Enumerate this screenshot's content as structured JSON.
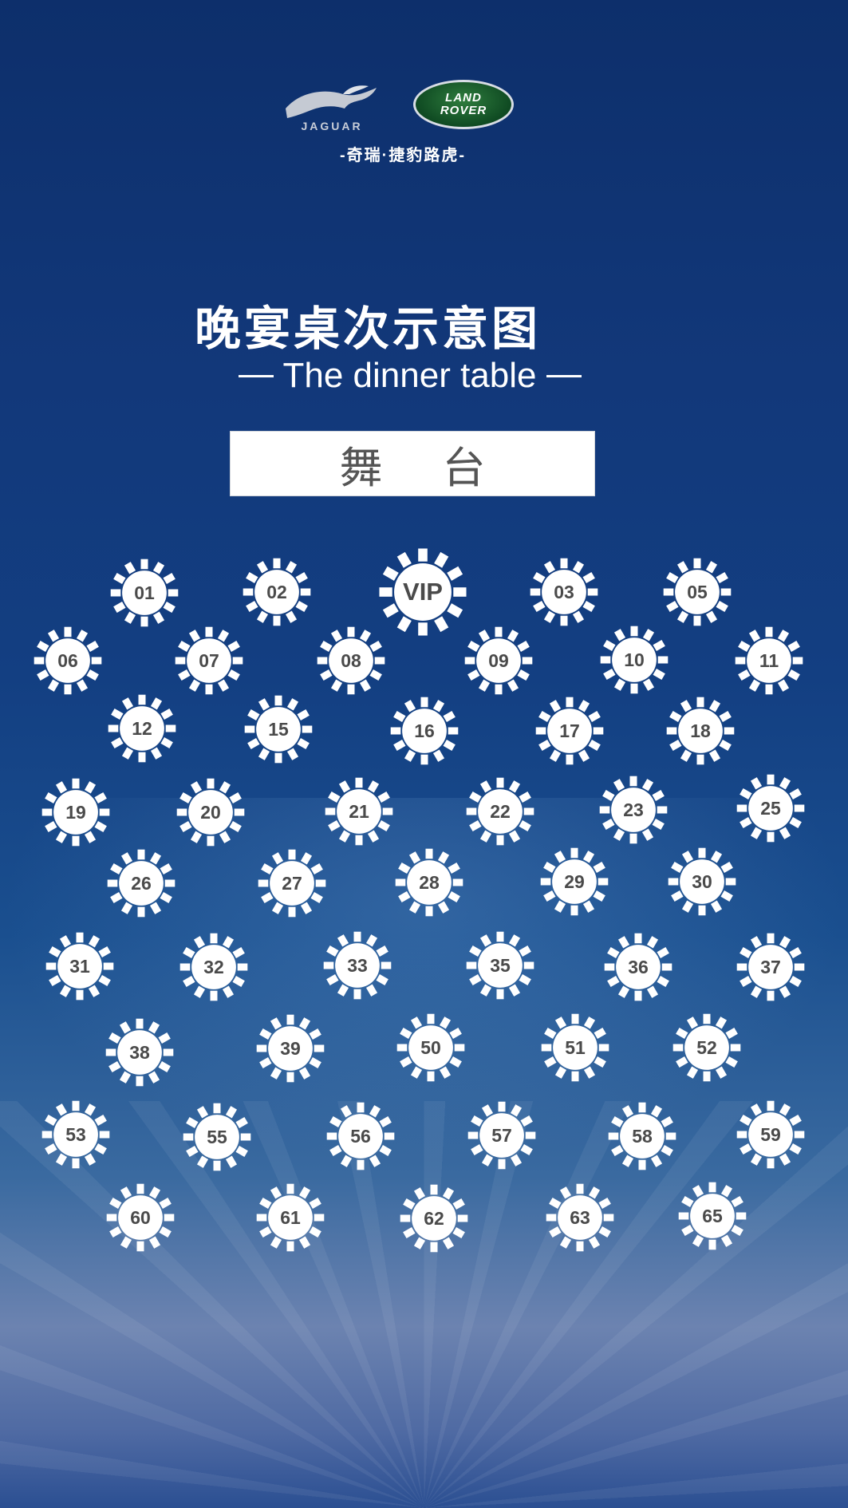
{
  "brand": {
    "jaguar_wordmark": "JAGUAR",
    "land_rover_line1": "LAND",
    "land_rover_line2": "ROVER",
    "chinese_name": "-奇瑞·捷豹路虎-"
  },
  "header": {
    "title": "晚宴桌次示意图",
    "subtitle": "The dinner table"
  },
  "stage": {
    "label": "舞 台"
  },
  "colors": {
    "background_top": "#0d2f6b",
    "background_bottom": "#2b4f92",
    "table_fill": "#ffffff",
    "table_text": "#4a4a4a",
    "land_rover_green": "#1f6a33"
  },
  "tables": [
    {
      "label": "01"
    },
    {
      "label": "02"
    },
    {
      "label": "VIP"
    },
    {
      "label": "03"
    },
    {
      "label": "05"
    },
    {
      "label": "06"
    },
    {
      "label": "07"
    },
    {
      "label": "08"
    },
    {
      "label": "09"
    },
    {
      "label": "10"
    },
    {
      "label": "11"
    },
    {
      "label": "12"
    },
    {
      "label": "15"
    },
    {
      "label": "16"
    },
    {
      "label": "17"
    },
    {
      "label": "18"
    },
    {
      "label": "19"
    },
    {
      "label": "20"
    },
    {
      "label": "21"
    },
    {
      "label": "22"
    },
    {
      "label": "23"
    },
    {
      "label": "25"
    },
    {
      "label": "26"
    },
    {
      "label": "27"
    },
    {
      "label": "28"
    },
    {
      "label": "29"
    },
    {
      "label": "30"
    },
    {
      "label": "31"
    },
    {
      "label": "32"
    },
    {
      "label": "33"
    },
    {
      "label": "35"
    },
    {
      "label": "36"
    },
    {
      "label": "37"
    },
    {
      "label": "38"
    },
    {
      "label": "39"
    },
    {
      "label": "50"
    },
    {
      "label": "51"
    },
    {
      "label": "52"
    },
    {
      "label": "53"
    },
    {
      "label": "55"
    },
    {
      "label": "56"
    },
    {
      "label": "57"
    },
    {
      "label": "58"
    },
    {
      "label": "59"
    },
    {
      "label": "60"
    },
    {
      "label": "61"
    },
    {
      "label": "62"
    },
    {
      "label": "63"
    },
    {
      "label": "65"
    }
  ]
}
